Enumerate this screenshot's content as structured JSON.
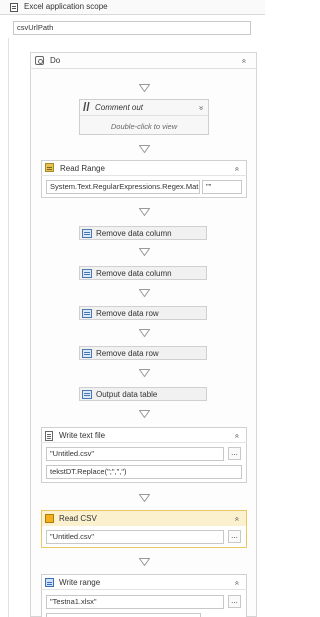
{
  "scope": {
    "title": "Excel application scope",
    "workbook_path": "csvUrlPath"
  },
  "do_sequence": {
    "title": "Do",
    "collapse_glyph": "»"
  },
  "comment_out": {
    "title": "Comment out",
    "hint": "Double-click to view",
    "expand_glyph": "»"
  },
  "read_range": {
    "title": "Read Range",
    "range_value": "System.Text.RegularExpressions.Regex.Mat",
    "sheet_value": "\"\"",
    "collapse_glyph": "»"
  },
  "activities": [
    {
      "label": "Remove data column"
    },
    {
      "label": "Remove data column"
    },
    {
      "label": "Remove data row"
    },
    {
      "label": "Remove data row"
    },
    {
      "label": "Output data table"
    }
  ],
  "write_text_file": {
    "title": "Write text file",
    "file_value": "\"Untitled.csv\"",
    "text_value": "tekstDT.Replace(\";\",\",\")",
    "collapse_glyph": "»",
    "browse_label": "..."
  },
  "read_csv": {
    "title": "Read CSV",
    "file_value": "\"Untitled.csv\"",
    "collapse_glyph": "»",
    "browse_label": "..."
  },
  "write_range": {
    "title": "Write range",
    "file_value": "\"Testna1.xlsx\"",
    "collapse_glyph": "»",
    "browse_label": "..."
  },
  "colors": {
    "read_csv_header": "#fbf1cf",
    "read_csv_border": "#e8c865",
    "activity_bg": "#f1f1f1"
  }
}
